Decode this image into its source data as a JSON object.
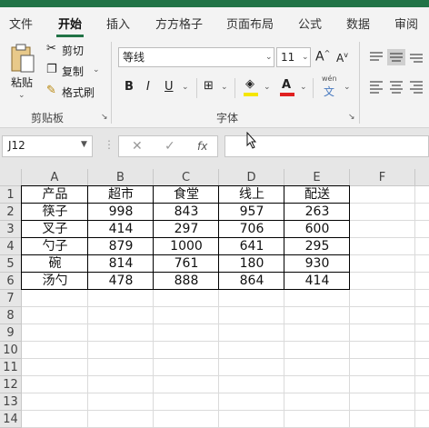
{
  "ribbon_tabs": [
    "文件",
    "开始",
    "插入",
    "方方格子",
    "页面布局",
    "公式",
    "数据",
    "审阅"
  ],
  "active_tab": "开始",
  "clipboard": {
    "paste_label": "粘贴",
    "cut_label": "剪切",
    "copy_label": "复制",
    "format_painter_label": "格式刷",
    "group_label": "剪贴板"
  },
  "font": {
    "font_name": "等线",
    "font_size": "11",
    "bold": "B",
    "italic": "I",
    "underline": "U",
    "group_label": "字体",
    "phonetic": "wén"
  },
  "name_box": "J12",
  "formula_content": "",
  "colors": {
    "accent": "#217346",
    "font_color": "#e02020",
    "fill_color": "#f5e600"
  },
  "grid": {
    "columns": [
      "A",
      "B",
      "C",
      "D",
      "E",
      "F"
    ],
    "rows": [
      "1",
      "2",
      "3",
      "4",
      "5",
      "6",
      "7",
      "8",
      "9",
      "10",
      "11",
      "12",
      "13",
      "14"
    ],
    "cells": [
      [
        "产品",
        "超市",
        "食堂",
        "线上",
        "配送"
      ],
      [
        "筷子",
        "998",
        "843",
        "957",
        "263"
      ],
      [
        "叉子",
        "414",
        "297",
        "706",
        "600"
      ],
      [
        "勺子",
        "879",
        "1000",
        "641",
        "295"
      ],
      [
        "碗",
        "814",
        "761",
        "180",
        "930"
      ],
      [
        "汤勺",
        "478",
        "888",
        "864",
        "414"
      ]
    ]
  }
}
